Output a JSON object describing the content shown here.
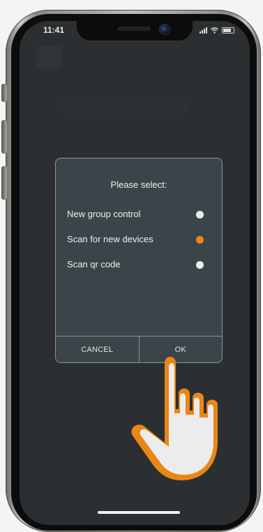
{
  "status_bar": {
    "time": "11:41"
  },
  "dialog": {
    "title": "Please select:",
    "options": [
      {
        "label": "New group control",
        "selected": false
      },
      {
        "label": "Scan for new devices",
        "selected": true
      },
      {
        "label": "Scan qr code",
        "selected": false
      }
    ],
    "cancel_label": "CANCEL",
    "ok_label": "OK"
  },
  "colors": {
    "accent": "#e98716",
    "dialog_bg": "#3b4449",
    "screen_bg": "#2b2f31"
  },
  "icons": {
    "pointer": "tap-hand-icon",
    "signal": "signal-icon",
    "wifi": "wifi-icon",
    "battery": "battery-icon"
  }
}
